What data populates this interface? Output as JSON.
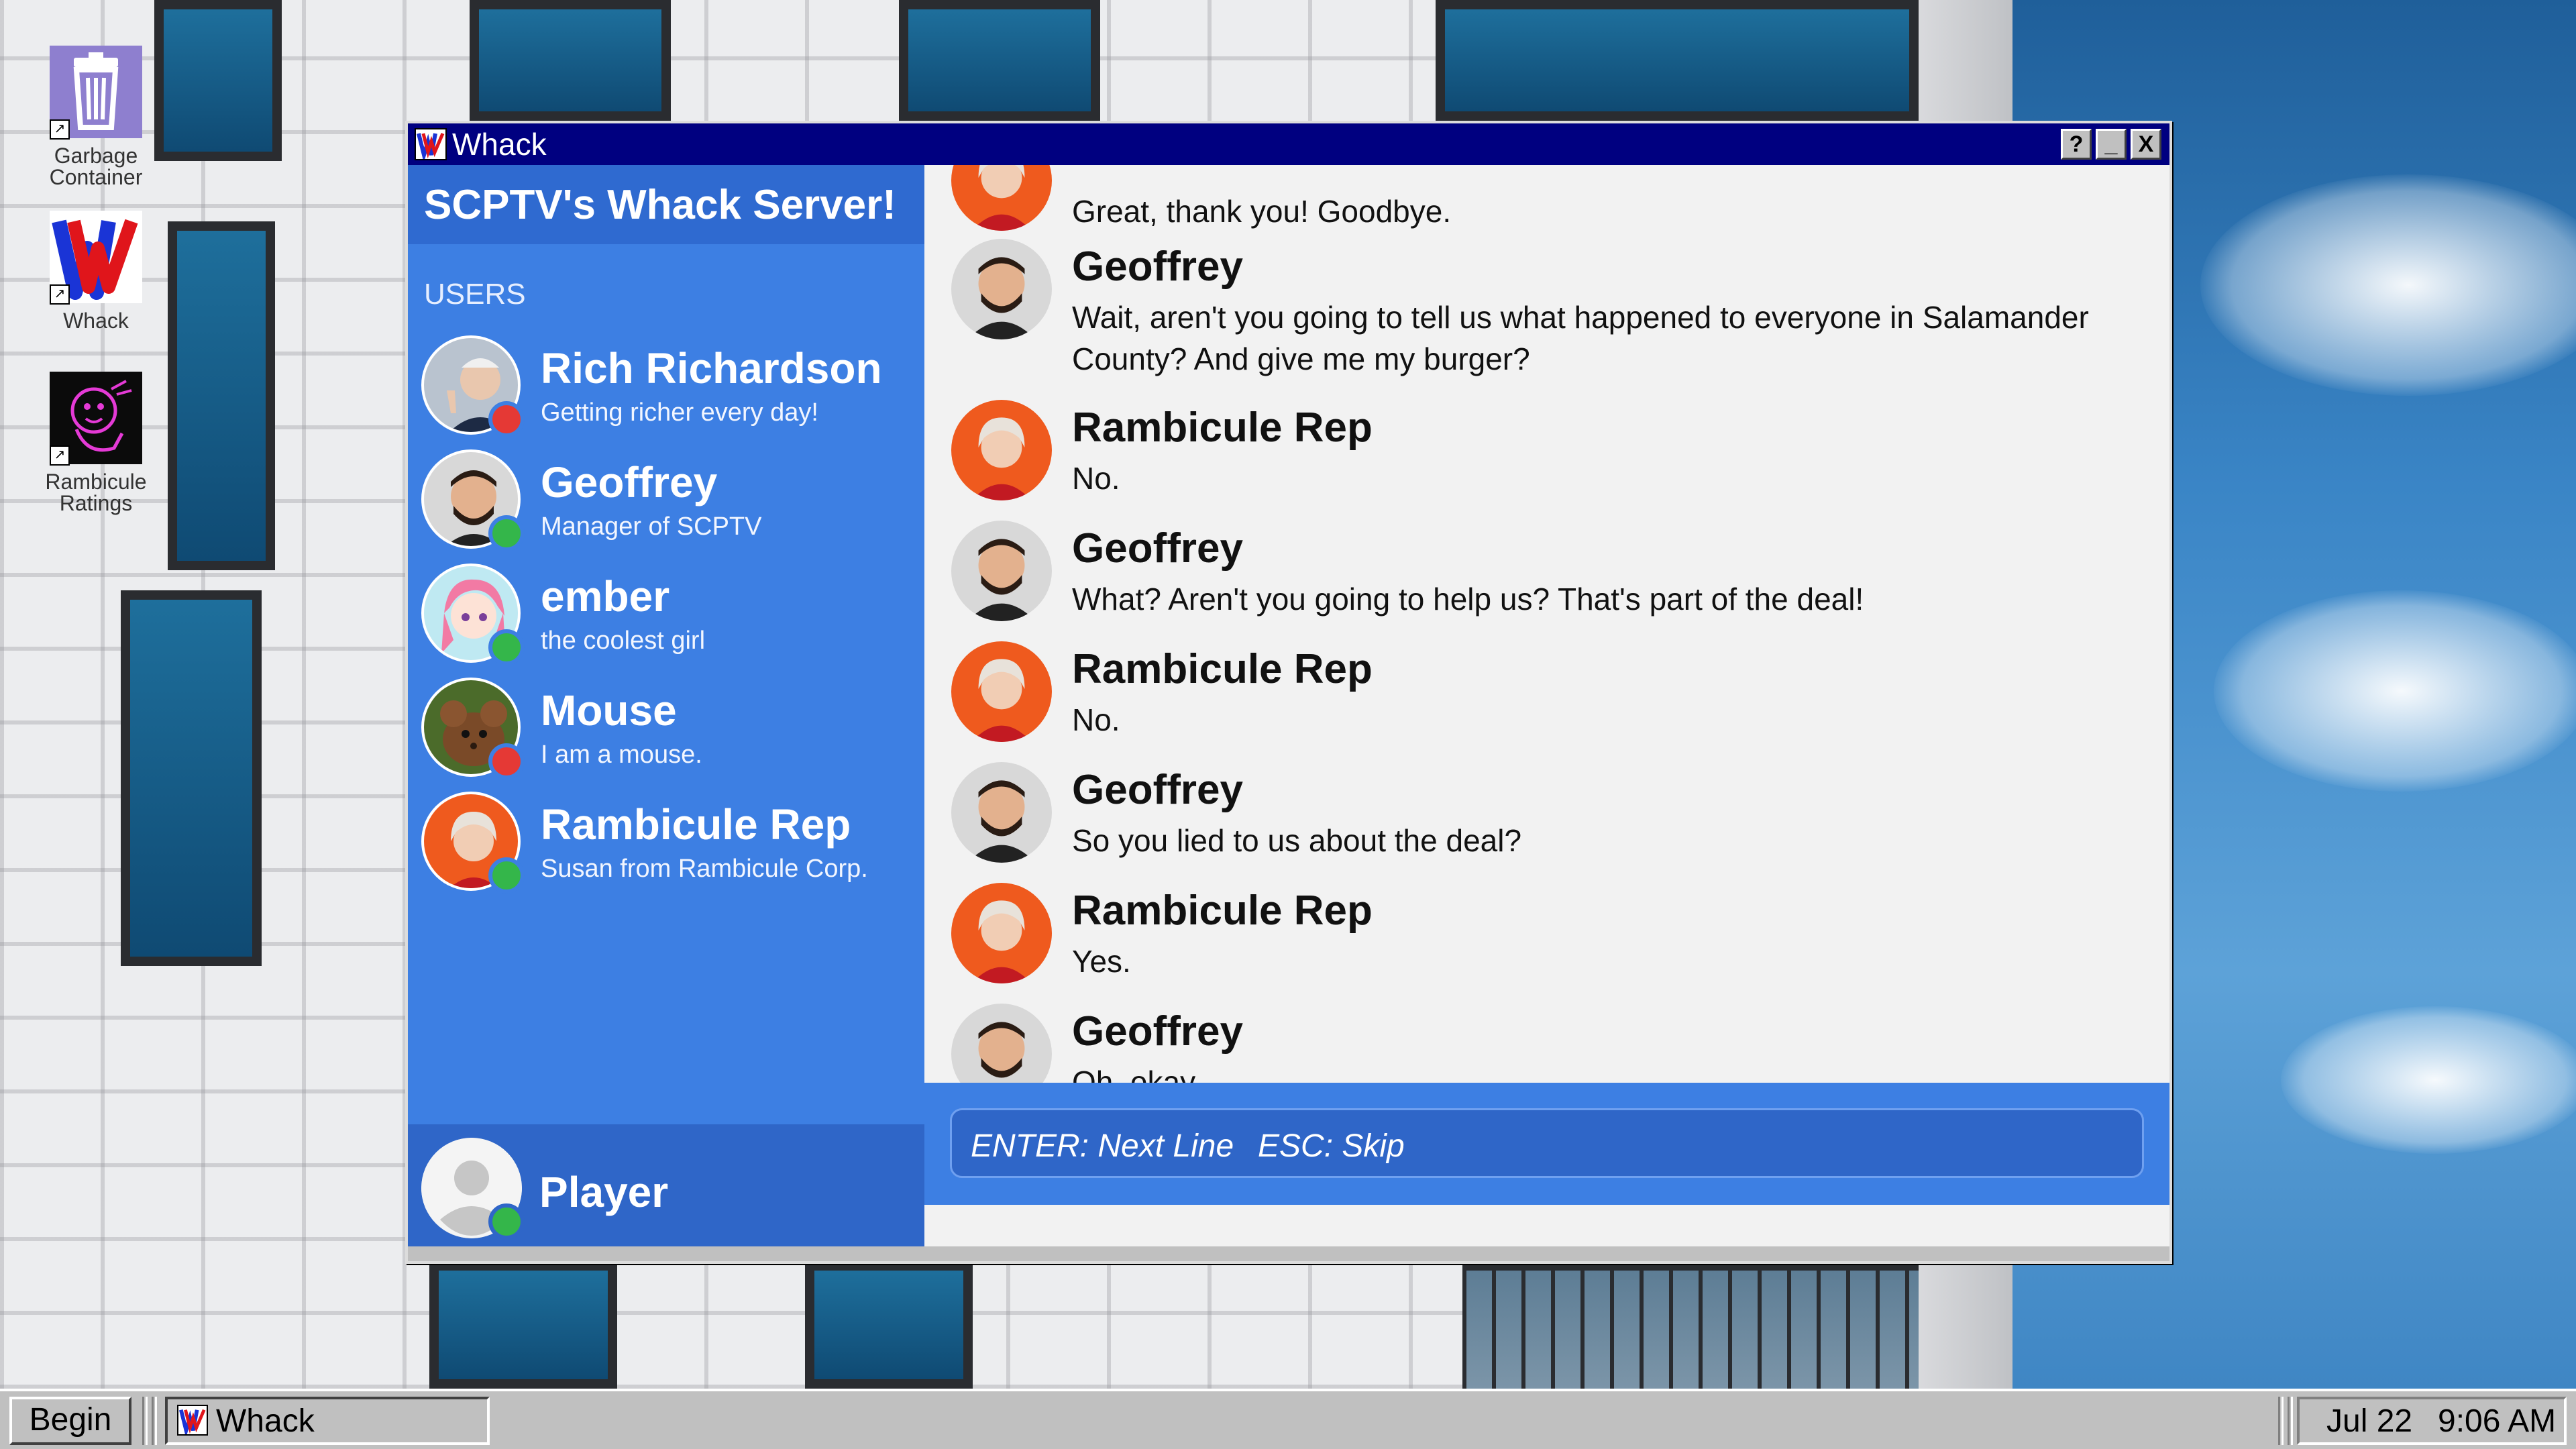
{
  "desktop": {
    "icons": [
      {
        "label": "Garbage Container",
        "icon": "trash-can-icon"
      },
      {
        "label": "Whack",
        "icon": "whack-logo-icon"
      },
      {
        "label": "Rambicule Ratings",
        "icon": "rambicule-ratings-icon"
      }
    ]
  },
  "window": {
    "title": "Whack",
    "buttons": [
      "?",
      "_",
      "X"
    ],
    "server_name": "SCPTV's Whack Server!",
    "users_label": "USERS",
    "users": [
      {
        "name": "Rich Richardson",
        "status_text": "Getting richer every day!",
        "presence": "offline",
        "presence_color": "#e53935"
      },
      {
        "name": "Geoffrey",
        "status_text": "Manager of SCPTV",
        "presence": "online",
        "presence_color": "#34b64a"
      },
      {
        "name": "ember",
        "status_text": "the coolest girl",
        "presence": "online",
        "presence_color": "#34b64a"
      },
      {
        "name": "Mouse",
        "status_text": "I am a mouse.",
        "presence": "offline",
        "presence_color": "#e53935"
      },
      {
        "name": "Rambicule Rep",
        "status_text": "Susan from Rambicule Corp.",
        "presence": "online",
        "presence_color": "#34b64a"
      }
    ],
    "player": {
      "name": "Player",
      "presence": "online"
    },
    "messages": [
      {
        "author": "Rambicule Rep",
        "text": "Great, thank you! Goodbye."
      },
      {
        "author": "Geoffrey",
        "text": "Wait, aren't you going to tell us what happened to everyone in Salamander County? And give me my burger?"
      },
      {
        "author": "Rambicule Rep",
        "text": "No."
      },
      {
        "author": "Geoffrey",
        "text": "What? Aren't you going to help us? That's part of the deal!"
      },
      {
        "author": "Rambicule Rep",
        "text": "No."
      },
      {
        "author": "Geoffrey",
        "text": "So you lied to us about the deal?"
      },
      {
        "author": "Rambicule Rep",
        "text": "Yes."
      },
      {
        "author": "Geoffrey",
        "text": "Oh, okay."
      }
    ],
    "input_hints": {
      "enter": "ENTER: Next Line",
      "esc": "ESC: Skip"
    }
  },
  "taskbar": {
    "begin_label": "Begin",
    "task_label": "Whack",
    "clock_date": "Jul 22",
    "clock_time": "9:06 AM"
  },
  "colors": {
    "titlebar": "#000080",
    "sidebar": "#3d7fe3",
    "online": "#34b64a",
    "offline": "#e53935"
  }
}
